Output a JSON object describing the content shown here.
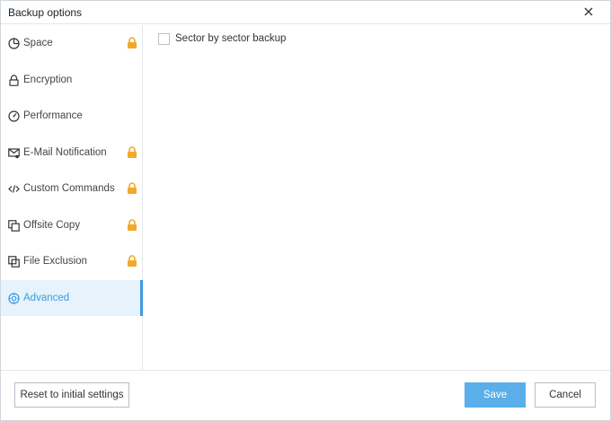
{
  "window": {
    "title": "Backup options",
    "close_icon": "close-icon"
  },
  "sidebar": {
    "items": [
      {
        "label": "Space",
        "icon": "pie-chart-icon",
        "locked": true
      },
      {
        "label": "Encryption",
        "icon": "lock-outline-icon",
        "locked": false
      },
      {
        "label": "Performance",
        "icon": "gauge-icon",
        "locked": false
      },
      {
        "label": "E-Mail Notification",
        "icon": "mail-notification-icon",
        "locked": true
      },
      {
        "label": "Custom Commands",
        "icon": "code-icon",
        "locked": true
      },
      {
        "label": "Offsite Copy",
        "icon": "copy-icon",
        "locked": true
      },
      {
        "label": "File Exclusion",
        "icon": "file-exclusion-icon",
        "locked": true
      },
      {
        "label": "Advanced",
        "icon": "advanced-gear-icon",
        "locked": false,
        "active": true
      }
    ]
  },
  "content": {
    "sector_backup": {
      "label": "Sector by sector backup",
      "checked": false
    }
  },
  "footer": {
    "reset_label": "Reset to initial settings",
    "save_label": "Save",
    "cancel_label": "Cancel"
  },
  "colors": {
    "accent": "#3d9be0",
    "save_button": "#5aaeea",
    "lock": "#f0a92a",
    "active_bg": "#e6f3fc"
  }
}
